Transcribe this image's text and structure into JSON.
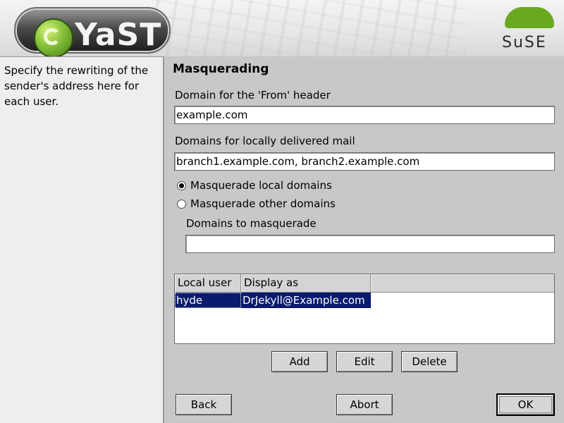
{
  "header": {
    "app_name": "YaST",
    "brand": "SuSE"
  },
  "help": {
    "text": "Specify the rewriting of the sender's address here for each user."
  },
  "form": {
    "title": "Masquerading",
    "from_domain": {
      "label": "Domain for the 'From' header",
      "value": "example.com"
    },
    "local_domains": {
      "label": "Domains for locally delivered mail",
      "value": "branch1.example.com, branch2.example.com"
    },
    "radio_local": {
      "label": "Masquerade local domains",
      "checked": true
    },
    "radio_other": {
      "label": "Masquerade other domains",
      "checked": false
    },
    "masq_domains": {
      "label": "Domains to masquerade",
      "value": ""
    }
  },
  "table": {
    "columns": [
      "Local user",
      "Display as"
    ],
    "rows": [
      {
        "local_user": "hyde",
        "display_as": "DrJekyll@Example.com",
        "selected": true
      }
    ]
  },
  "buttons": {
    "add": "Add",
    "edit": "Edit",
    "delete": "Delete",
    "back": "Back",
    "abort": "Abort",
    "ok": "OK"
  }
}
